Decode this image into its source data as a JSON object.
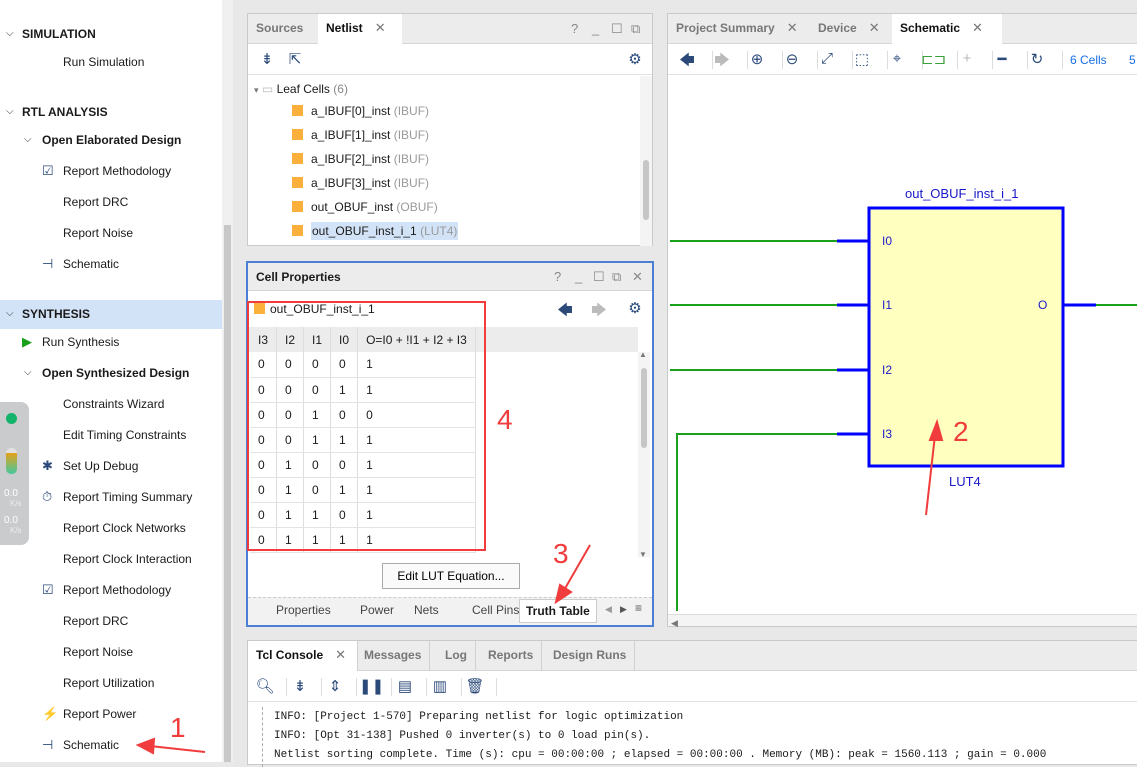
{
  "flow_navigator": {
    "items": [
      {
        "label": "SIMULATION",
        "type": "section"
      },
      {
        "label": "Run Simulation"
      },
      {
        "label": "RTL ANALYSIS",
        "type": "section"
      },
      {
        "label": "Open Elaborated Design",
        "type": "group"
      },
      {
        "label": "Report Methodology",
        "icon": "clipboard-check-icon"
      },
      {
        "label": "Report DRC"
      },
      {
        "label": "Report Noise"
      },
      {
        "label": "Schematic",
        "icon": "schematic-icon"
      },
      {
        "label": "SYNTHESIS",
        "type": "section",
        "selected": true
      },
      {
        "label": "Run Synthesis",
        "icon": "play-icon"
      },
      {
        "label": "Open Synthesized Design",
        "type": "group"
      },
      {
        "label": "Constraints Wizard"
      },
      {
        "label": "Edit Timing Constraints"
      },
      {
        "label": "Set Up Debug",
        "icon": "bug-icon"
      },
      {
        "label": "Report Timing Summary",
        "icon": "timer-icon"
      },
      {
        "label": "Report Clock Networks"
      },
      {
        "label": "Report Clock Interaction"
      },
      {
        "label": "Report Methodology",
        "icon": "clipboard-check-icon"
      },
      {
        "label": "Report DRC"
      },
      {
        "label": "Report Noise"
      },
      {
        "label": "Report Utilization"
      },
      {
        "label": "Report Power",
        "icon": "power-plug-icon"
      },
      {
        "label": "Schematic",
        "icon": "schematic-icon"
      }
    ]
  },
  "net_widget": {
    "up": "0.0",
    "up_unit": "K/s",
    "down": "0.0",
    "down_unit": "K/s"
  },
  "netlist_panel": {
    "tabs": [
      "Sources",
      "Netlist"
    ],
    "active_tab": "Netlist",
    "folder": {
      "label": "Leaf Cells",
      "count": "(6)"
    },
    "cells": [
      {
        "name": "a_IBUF[0]_inst",
        "type": "(IBUF)"
      },
      {
        "name": "a_IBUF[1]_inst",
        "type": "(IBUF)"
      },
      {
        "name": "a_IBUF[2]_inst",
        "type": "(IBUF)"
      },
      {
        "name": "a_IBUF[3]_inst",
        "type": "(IBUF)"
      },
      {
        "name": "out_OBUF_inst",
        "type": "(OBUF)"
      },
      {
        "name": "out_OBUF_inst_i_1",
        "type": "(LUT4)",
        "selected": true
      }
    ]
  },
  "cell_properties": {
    "title": "Cell Properties",
    "cell_name": "out_OBUF_inst_i_1",
    "columns": [
      "I3",
      "I2",
      "I1",
      "I0",
      "O=I0 + !I1 + I2 + I3"
    ],
    "rows": [
      [
        "0",
        "0",
        "0",
        "0",
        "1"
      ],
      [
        "0",
        "0",
        "0",
        "1",
        "1"
      ],
      [
        "0",
        "0",
        "1",
        "0",
        "0"
      ],
      [
        "0",
        "0",
        "1",
        "1",
        "1"
      ],
      [
        "0",
        "1",
        "0",
        "0",
        "1"
      ],
      [
        "0",
        "1",
        "0",
        "1",
        "1"
      ],
      [
        "0",
        "1",
        "1",
        "0",
        "1"
      ],
      [
        "0",
        "1",
        "1",
        "1",
        "1"
      ]
    ],
    "edit_button": "Edit LUT Equation...",
    "tabs": [
      "Properties",
      "Power",
      "Nets",
      "Cell Pins",
      "Truth Table"
    ],
    "active_tab": "Truth Table"
  },
  "schematic_panel": {
    "tabs": [
      "Project Summary",
      "Device",
      "Schematic"
    ],
    "active_tab": "Schematic",
    "cells_link": "6 Cells",
    "more_link": "5",
    "cell_instance": "out_OBUF_inst_i_1",
    "cell_type": "LUT4",
    "inputs": [
      "I0",
      "I1",
      "I2",
      "I3"
    ],
    "output": "O",
    "colors": {
      "cell_border": "#0000ff",
      "cell_fill": "#ffffc0",
      "wire": "#1aa01a"
    }
  },
  "console": {
    "tabs": [
      "Tcl Console",
      "Messages",
      "Log",
      "Reports",
      "Design Runs"
    ],
    "active_tab": "Tcl Console",
    "lines": [
      "INFO: [Project 1-570] Preparing netlist for logic optimization",
      "INFO: [Opt 31-138] Pushed 0 inverter(s) to 0 load pin(s).",
      "Netlist sorting complete. Time (s): cpu = 00:00:00 ; elapsed = 00:00:00 . Memory (MB): peak = 1560.113 ; gain = 0.000"
    ]
  },
  "annotations": [
    "1",
    "2",
    "3",
    "4"
  ],
  "annotation_color": "#f03c3c"
}
